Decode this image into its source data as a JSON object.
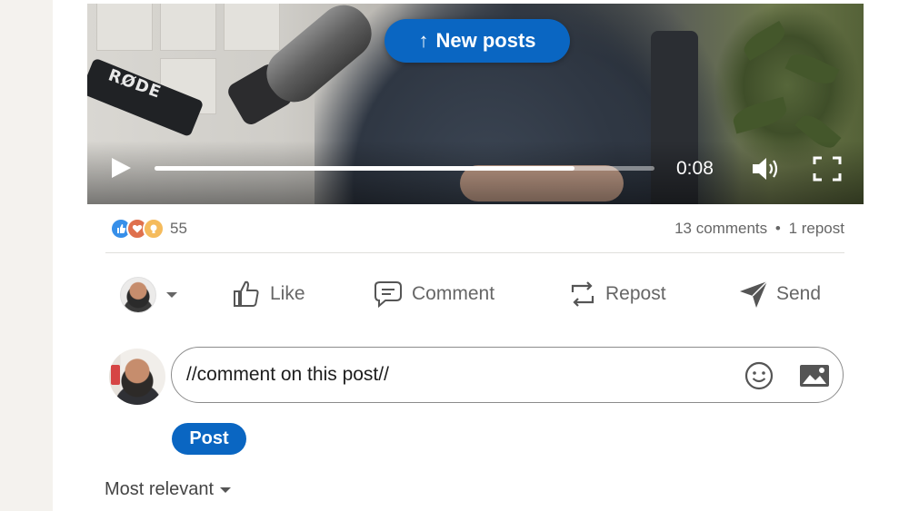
{
  "banner": {
    "new_posts_label": "New posts",
    "arrow_icon": "arrow-up-icon"
  },
  "video": {
    "brand_label": "RØDE",
    "time": "0:08",
    "progress_fraction": 0.84,
    "play_icon": "play-icon",
    "volume_icon": "volume-icon",
    "fullscreen_icon": "fullscreen-icon"
  },
  "social": {
    "reaction_icons": [
      "like-icon",
      "love-icon",
      "insightful-icon"
    ],
    "reaction_count": "55",
    "comments": "13 comments",
    "separator": "•",
    "reposts": "1 repost"
  },
  "actions": {
    "like": "Like",
    "comment": "Comment",
    "repost": "Repost",
    "send": "Send"
  },
  "comment_box": {
    "value": "//comment on this post//",
    "post_label": "Post"
  },
  "sort": {
    "label": "Most relevant"
  },
  "colors": {
    "brand_blue": "#0a66c2",
    "muted_text": "#666666"
  }
}
